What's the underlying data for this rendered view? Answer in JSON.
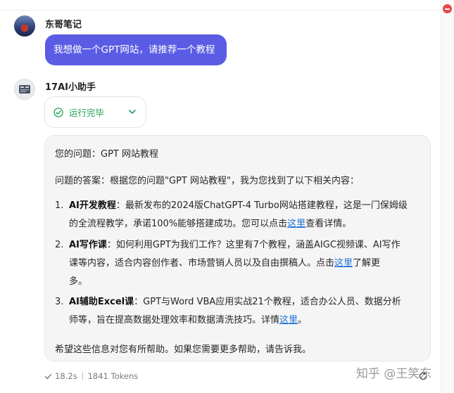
{
  "user": {
    "name": "东哥笔记",
    "message": "我想做一个GPT网站，请推荐一个教程"
  },
  "bot": {
    "name": "17AI小助手",
    "status": "运行完毕"
  },
  "answer": {
    "question_line": "您的问题：GPT 网站教程",
    "intro_line": "问题的答案：根据您的问题\"GPT 网站教程\"，我为您找到了以下相关内容：",
    "items": [
      {
        "num": "1.",
        "title": "AI开发教程",
        "line1": "：最新发布的2024版ChatGPT-4 Turbo网站搭建教程，这是一门保姆级",
        "line2_a": "的全流程教学，承诺100%能够搭建成功。您可以点击",
        "link": "这里",
        "line2_b": "查看详情。"
      },
      {
        "num": "2.",
        "title": "AI写作课",
        "line1": "：如何利用GPT为我们工作？这里有7个教程，涵盖AIGC视频课、AI写作",
        "line2_a": "课等内容，适合内容创作者、市场营销人员以及自由撰稿人。点击",
        "link": "这里",
        "line2_b": "了解更",
        "line3": "多。"
      },
      {
        "num": "3.",
        "title": "AI辅助Excel课",
        "line1": "：GPT与Word VBA应用实战21个教程，适合办公人员、数据分析",
        "line2_a": "师等，旨在提高数据处理效率和数据清洗技巧。详情",
        "link": "这里",
        "line2_b": "。"
      }
    ],
    "closing_line": "希望这些信息对您有所帮助。如果您需要更多帮助，请告诉我。"
  },
  "footer": {
    "time": "18.2s",
    "tokens": "1841 Tokens"
  },
  "watermark": "知乎 @王笑东",
  "colors": {
    "accent": "#5b5ce4",
    "success": "#22a15a",
    "link": "#1a6fd6"
  }
}
